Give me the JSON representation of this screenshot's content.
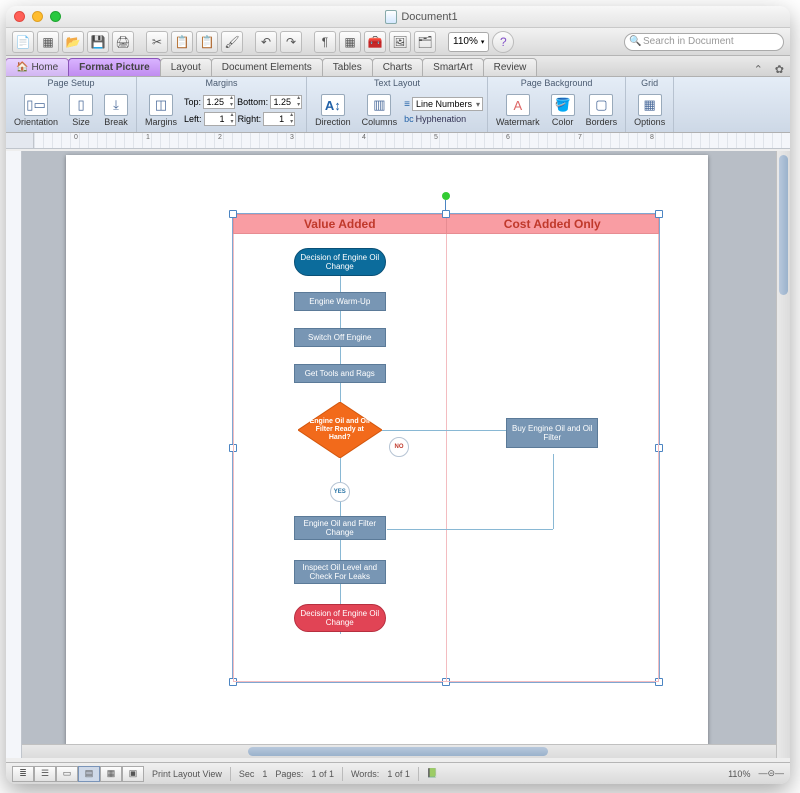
{
  "title": "Document1",
  "toolbar": {
    "zoom": "110%",
    "search_placeholder": "Search in Document"
  },
  "tabs": {
    "home": "Home",
    "format_picture": "Format Picture",
    "layout": "Layout",
    "doc_elements": "Document Elements",
    "tables": "Tables",
    "charts": "Charts",
    "smartart": "SmartArt",
    "review": "Review"
  },
  "ribbon": {
    "page_setup": {
      "header": "Page Setup",
      "orientation": "Orientation",
      "size": "Size",
      "break": "Break"
    },
    "margins": {
      "header": "Margins",
      "btn": "Margins",
      "top_label": "Top:",
      "top_val": "1.25",
      "bottom_label": "Bottom:",
      "bottom_val": "1.25",
      "left_label": "Left:",
      "left_val": "1",
      "right_label": "Right:",
      "right_val": "1"
    },
    "text_layout": {
      "header": "Text Layout",
      "direction": "Direction",
      "columns": "Columns",
      "line_numbers": "Line Numbers",
      "hyphenation": "Hyphenation"
    },
    "page_bg": {
      "header": "Page Background",
      "watermark": "Watermark",
      "color": "Color",
      "borders": "Borders"
    },
    "grid": {
      "header": "Grid",
      "options": "Options"
    }
  },
  "ruler": [
    "0",
    "1",
    "2",
    "3",
    "4",
    "5",
    "6",
    "7",
    "8"
  ],
  "flowchart": {
    "col1": "Value Added",
    "col2": "Cost Added Only",
    "start": "Decision of\nEngine Oil Change",
    "warmup": "Engine Warm-Up",
    "switchoff": "Switch Off Engine",
    "tools": "Get Tools and Rags",
    "decision": "Engine Oil\nand Oil Filter Ready\nat Hand?",
    "no": "NO",
    "yes": "YES",
    "buy": "Buy Engine Oil\nand Oil Filter",
    "change": "Engine Oil and Filter\nChange",
    "inspect": "Inspect Oil Level and\nCheck For Leaks",
    "end": "Decision of\nEngine Oil Change"
  },
  "status": {
    "view": "Print Layout View",
    "sec_l": "Sec",
    "sec_v": "1",
    "pages_l": "Pages:",
    "pages_v": "1 of 1",
    "words_l": "Words:",
    "words_v": "1 of 1",
    "zoom": "110%"
  }
}
